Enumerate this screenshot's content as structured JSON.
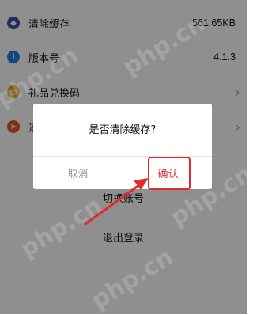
{
  "settings": {
    "items": [
      {
        "label": "清除缓存",
        "value": "561.65KB",
        "icon": "shield-icon",
        "color": "#3d4fa8"
      },
      {
        "label": "版本号",
        "value": "4.1.3",
        "icon": "info-icon",
        "color": "#2a7be0"
      },
      {
        "label": "礼品兑换码",
        "value": "",
        "icon": "gift-icon",
        "color": "#e0a21a"
      },
      {
        "label": "递",
        "value": "",
        "icon": "send-icon",
        "color": "#e05a22"
      }
    ],
    "switch_account": "切换账号",
    "logout": "退出登录"
  },
  "dialog": {
    "message": "是否清除缓存?",
    "cancel": "取消",
    "confirm": "确认"
  },
  "watermark": "php.cn",
  "colors": {
    "accent": "#e02c2c",
    "overlay": "rgba(0,0,0,0.44)"
  }
}
